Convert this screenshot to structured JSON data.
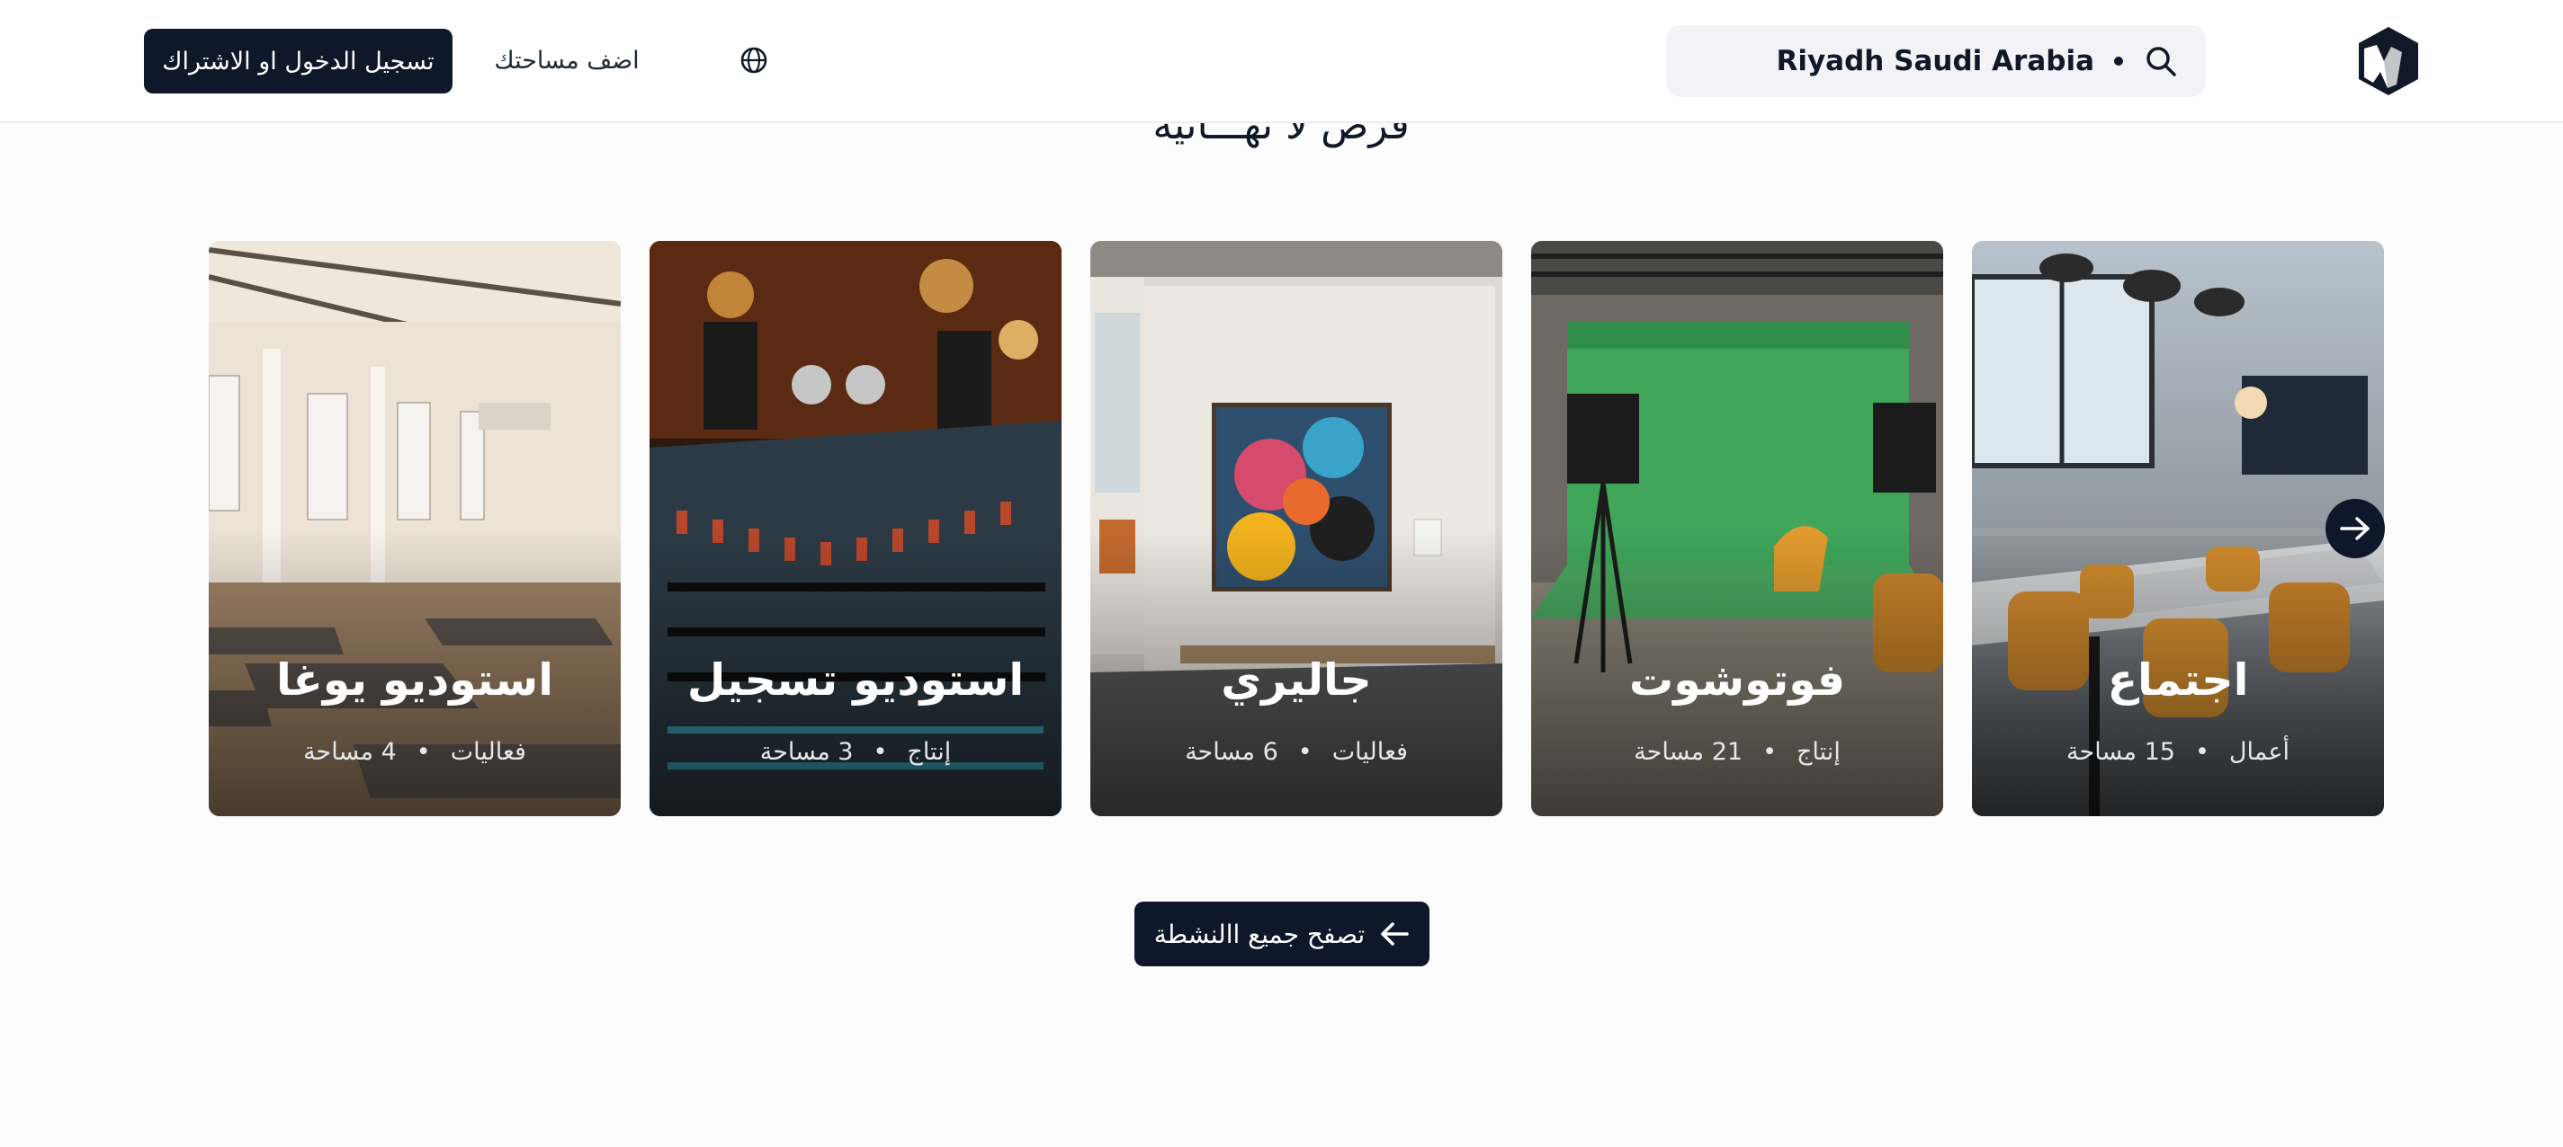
{
  "header": {
    "search_location": "Riyadh Saudi Arabia",
    "add_space_label": "اضف مساحتك",
    "login_label": "تسجيل الدخول او الاشتراك"
  },
  "section": {
    "title": "فرص لا نهـــائية"
  },
  "cards": [
    {
      "title": "اجتماع",
      "category": "أعمال",
      "count": "15 مساحة"
    },
    {
      "title": "فوتوشوت",
      "category": "إنتاج",
      "count": "21 مساحة"
    },
    {
      "title": "جاليري",
      "category": "فعاليات",
      "count": "6 مساحة"
    },
    {
      "title": "استوديو تسجيل",
      "category": "إنتاج",
      "count": "3 مساحة"
    },
    {
      "title": "استوديو يوغا",
      "category": "فعاليات",
      "count": "4 مساحة"
    }
  ],
  "browse_label": "تصفح جميع االنشطة",
  "colors": {
    "primary": "#0f172a",
    "background": "#fdfcfd"
  }
}
